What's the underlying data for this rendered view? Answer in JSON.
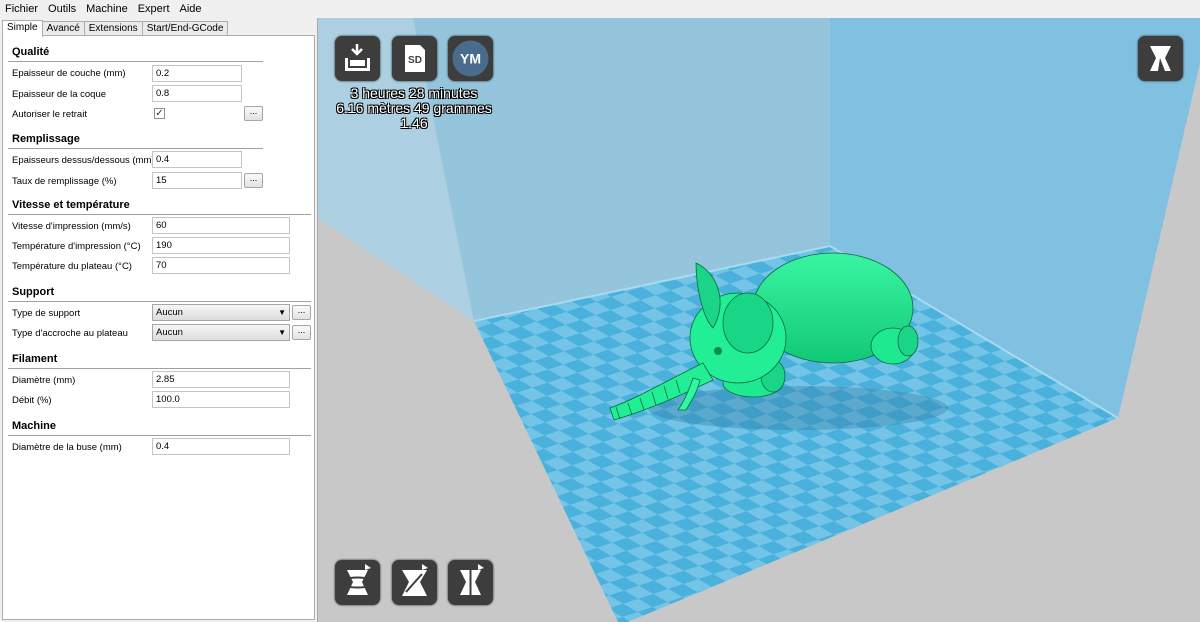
{
  "menu": [
    "Fichier",
    "Outils",
    "Machine",
    "Expert",
    "Aide"
  ],
  "tabs": [
    "Simple",
    "Avancé",
    "Extensions",
    "Start/End-GCode"
  ],
  "sections": {
    "quality": {
      "title": "Qualité",
      "layer_height": {
        "label": "Epaisseur de couche (mm)",
        "value": "0.2"
      },
      "shell_thickness": {
        "label": "Epaisseur de la coque",
        "value": "0.8"
      },
      "retraction": {
        "label": "Autoriser le retrait",
        "checked": true
      }
    },
    "fill": {
      "title": "Remplissage",
      "top_bottom": {
        "label": "Epaisseurs dessus/dessous (mm)",
        "value": "0.4"
      },
      "density": {
        "label": "Taux de remplissage (%)",
        "value": "15"
      }
    },
    "speed": {
      "title": "Vitesse et température",
      "print_speed": {
        "label": "Vitesse d'impression (mm/s)",
        "value": "60"
      },
      "print_temp": {
        "label": "Température d'impression (°C)",
        "value": "190"
      },
      "bed_temp": {
        "label": "Température du plateau (°C)",
        "value": "70"
      }
    },
    "support": {
      "title": "Support",
      "support_type": {
        "label": "Type de support",
        "value": "Aucun"
      },
      "adhesion": {
        "label": "Type d'accroche au plateau",
        "value": "Aucun"
      }
    },
    "filament": {
      "title": "Filament",
      "diameter": {
        "label": "Diamètre (mm)",
        "value": "2.85"
      },
      "flow": {
        "label": "Débit (%)",
        "value": "100.0"
      }
    },
    "machine": {
      "title": "Machine",
      "nozzle": {
        "label": "Diamètre de la buse (mm)",
        "value": "0.4"
      }
    }
  },
  "dots_label": "...",
  "viewport": {
    "buttons": {
      "load": "load-icon",
      "sd": "SD",
      "ym": "YM"
    },
    "stats": {
      "time": "3 heures 28 minutes",
      "material": "6.16 mètres 49 grammes",
      "cost": "1.46"
    },
    "model_color": "#1ee890",
    "bed_colors": [
      "#4ab0dc",
      "#73c4e6"
    ]
  }
}
